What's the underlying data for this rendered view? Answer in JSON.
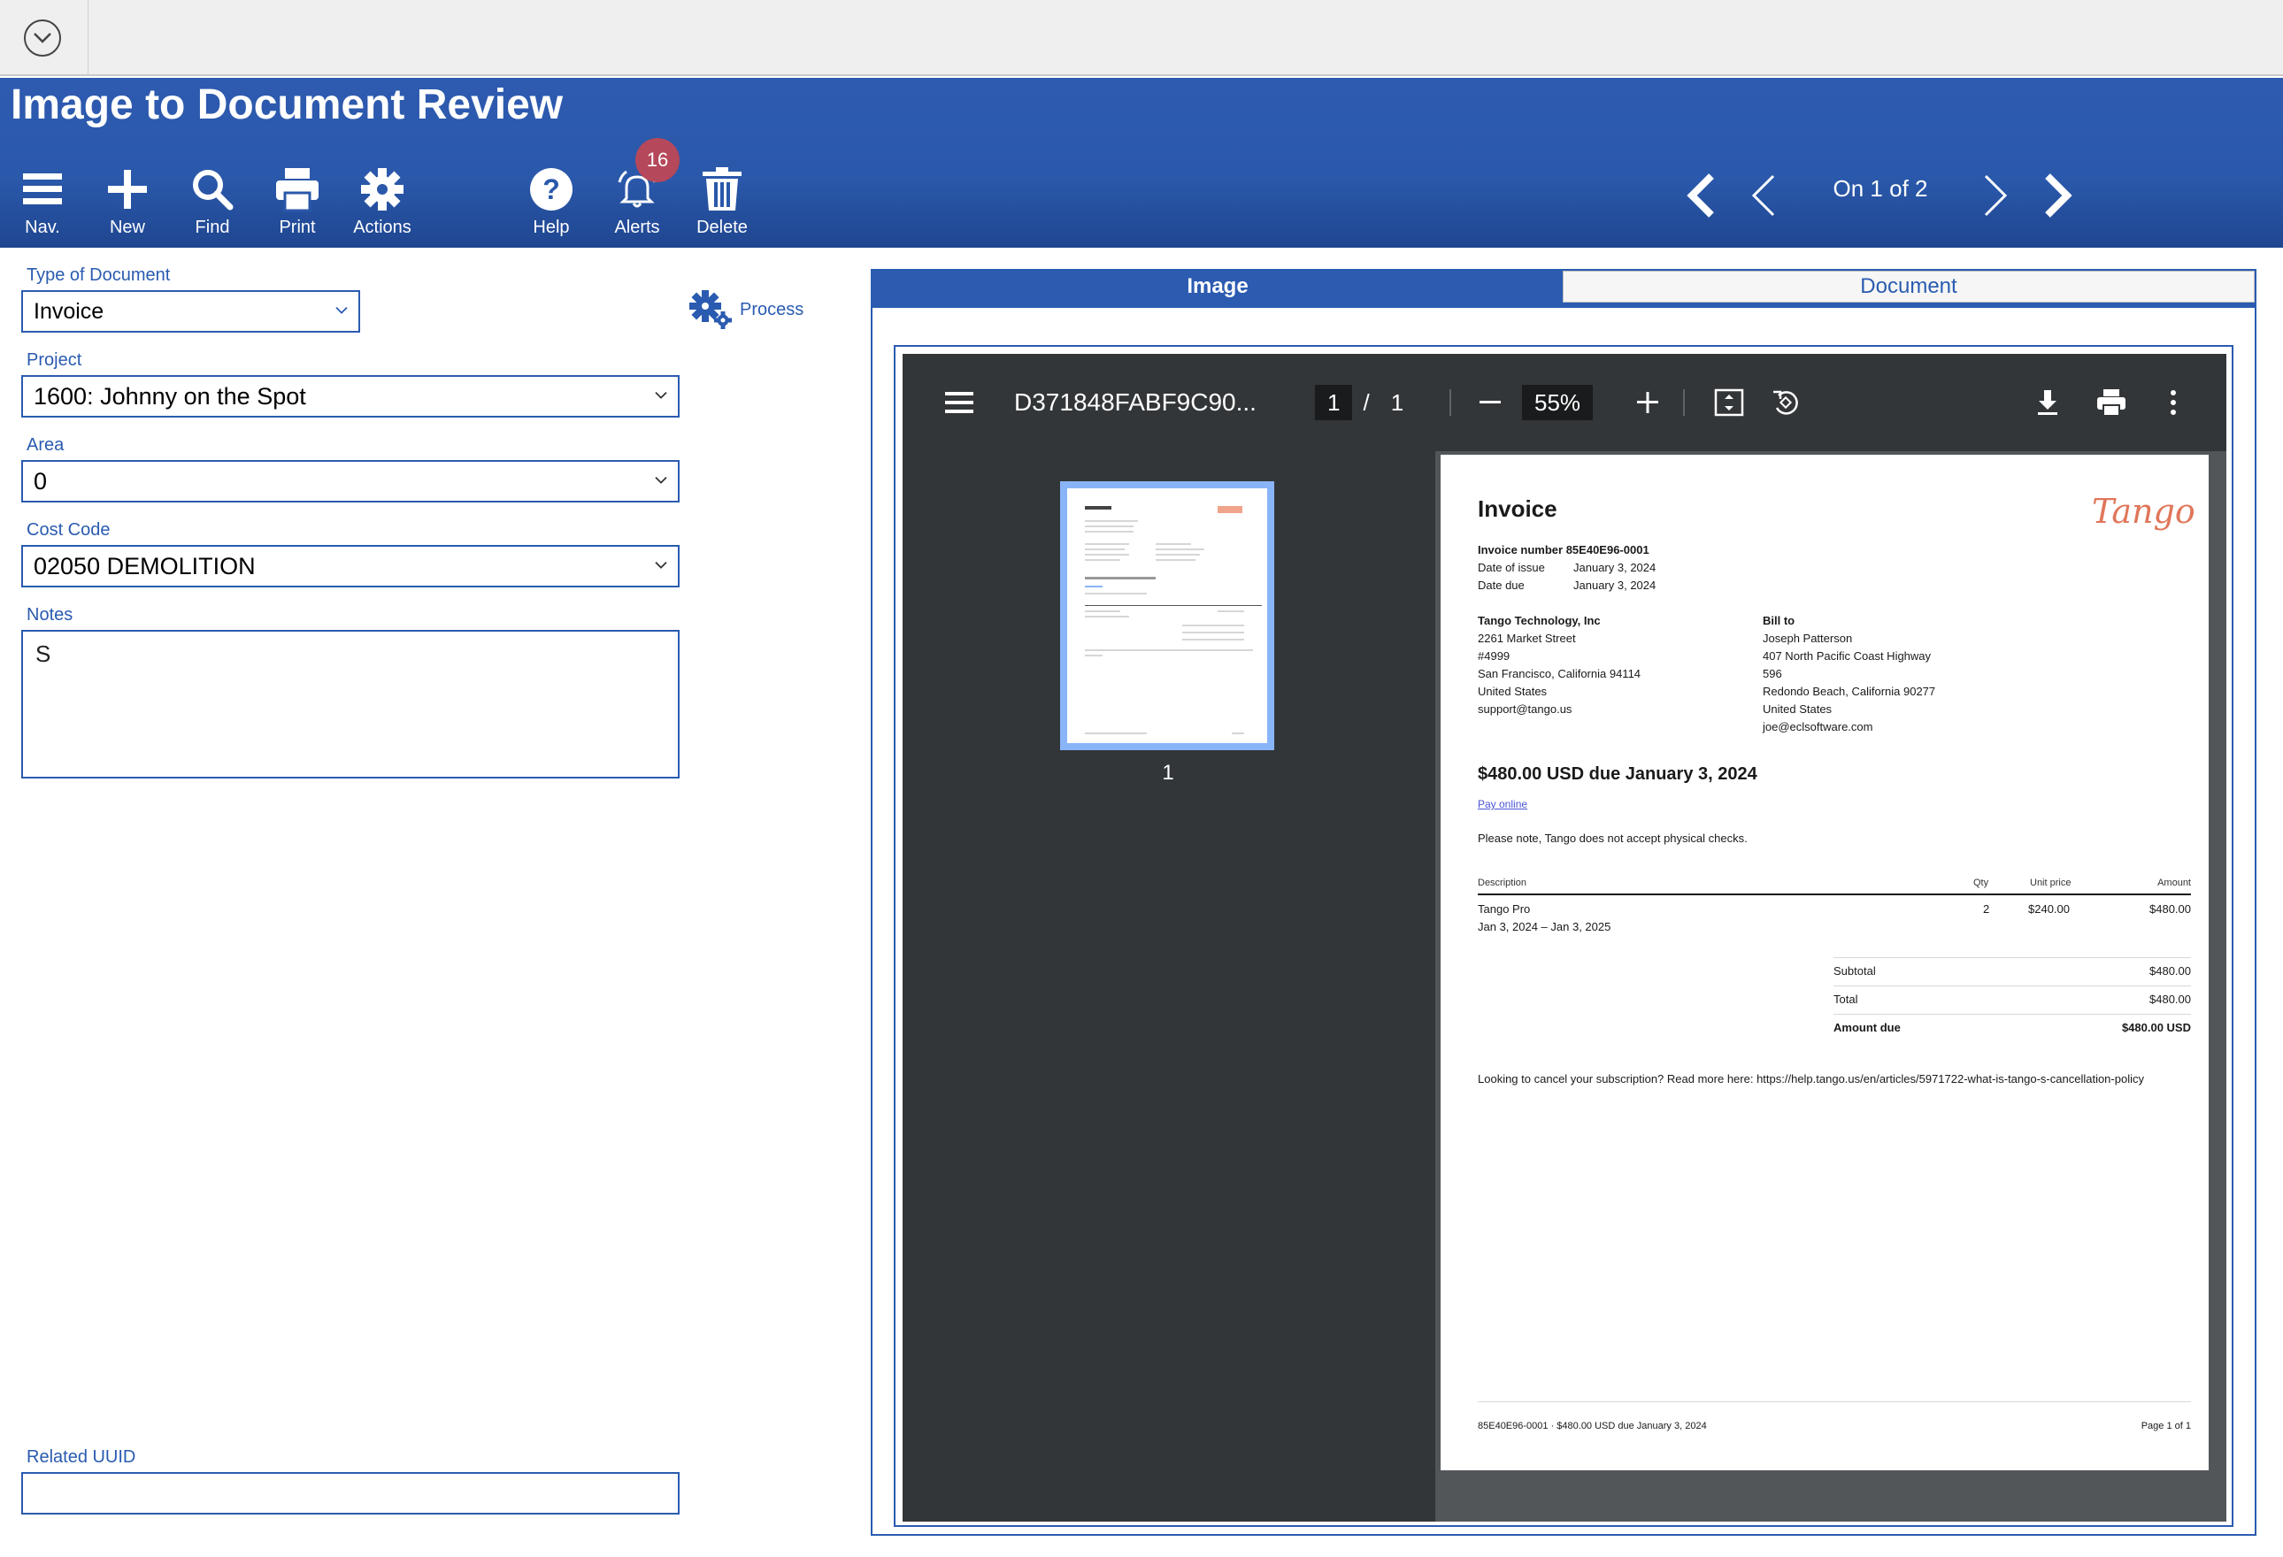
{
  "header": {
    "title": "Image to Document Review",
    "toolbar": [
      {
        "key": "nav",
        "label": "Nav.",
        "icon": "menu-icon"
      },
      {
        "key": "new",
        "label": "New",
        "icon": "plus-icon"
      },
      {
        "key": "find",
        "label": "Find",
        "icon": "search-icon"
      },
      {
        "key": "print",
        "label": "Print",
        "icon": "printer-icon"
      },
      {
        "key": "actions",
        "label": "Actions",
        "icon": "gear-icon"
      },
      {
        "key": "help",
        "label": "Help",
        "icon": "help-icon"
      },
      {
        "key": "alerts",
        "label": "Alerts",
        "icon": "bell-icon"
      },
      {
        "key": "delete",
        "label": "Delete",
        "icon": "trash-icon"
      }
    ],
    "alerts_count": "16",
    "pager": {
      "text": "On 1 of 2"
    }
  },
  "form": {
    "type_of_document": {
      "label": "Type of Document",
      "value": "Invoice"
    },
    "project": {
      "label": "Project",
      "value": "1600: Johnny on the Spot"
    },
    "area": {
      "label": "Area",
      "value": "0"
    },
    "cost_code": {
      "label": "Cost Code",
      "value": "02050 DEMOLITION"
    },
    "notes": {
      "label": "Notes",
      "value": "S"
    },
    "related_uuid": {
      "label": "Related UUID",
      "value": ""
    },
    "process_label": "Process"
  },
  "tabs": [
    {
      "label": "Image",
      "active": true
    },
    {
      "label": "Document",
      "active": false
    }
  ],
  "viewer": {
    "filename": "D371848FABF9C90...",
    "page_current": "1",
    "page_sep": "/",
    "page_total": "1",
    "zoom": "55%",
    "thumb_label": "1"
  },
  "invoice": {
    "title": "Invoice",
    "logo_text": "Tango",
    "meta": [
      {
        "label": "Invoice number",
        "value": "85E40E96-0001"
      },
      {
        "label": "Date of issue",
        "value": "January 3, 2024"
      },
      {
        "label": "Date due",
        "value": "January 3, 2024"
      }
    ],
    "from": [
      "Tango Technology, Inc",
      "2261 Market Street",
      "#4999",
      "San Francisco, California 94114",
      "United States",
      "support@tango.us"
    ],
    "bill_to": [
      "Bill to",
      "Joseph Patterson",
      "407 North Pacific Coast Highway",
      "596",
      "Redondo Beach, California 90277",
      "United States",
      "joe@eclsoftware.com"
    ],
    "amount_due_heading": "$480.00 USD due January 3, 2024",
    "pay_online": "Pay online",
    "note": "Please note, Tango does not accept physical checks.",
    "table_headers": {
      "description": "Description",
      "qty": "Qty",
      "unit_price": "Unit price",
      "amount": "Amount"
    },
    "line_item": {
      "description": "Tango Pro",
      "period": "Jan 3, 2024 – Jan 3, 2025",
      "qty": "2",
      "unit_price": "$240.00",
      "amount": "$480.00"
    },
    "totals": [
      {
        "label": "Subtotal",
        "value": "$480.00"
      },
      {
        "label": "Total",
        "value": "$480.00"
      },
      {
        "label": "Amount due",
        "value": "$480.00 USD"
      }
    ],
    "cancel_note": "Looking to cancel your subscription? Read more here: https://help.tango.us/en/articles/5971722-what-is-tango-s-cancellation-policy",
    "footer_left": "85E40E96-0001 · $480.00 USD due January 3, 2024",
    "footer_right": "Page 1 of 1"
  },
  "colors": {
    "brand_blue": "#2a5bb0",
    "badge": "#b5485a",
    "logo": "#e0765a"
  }
}
